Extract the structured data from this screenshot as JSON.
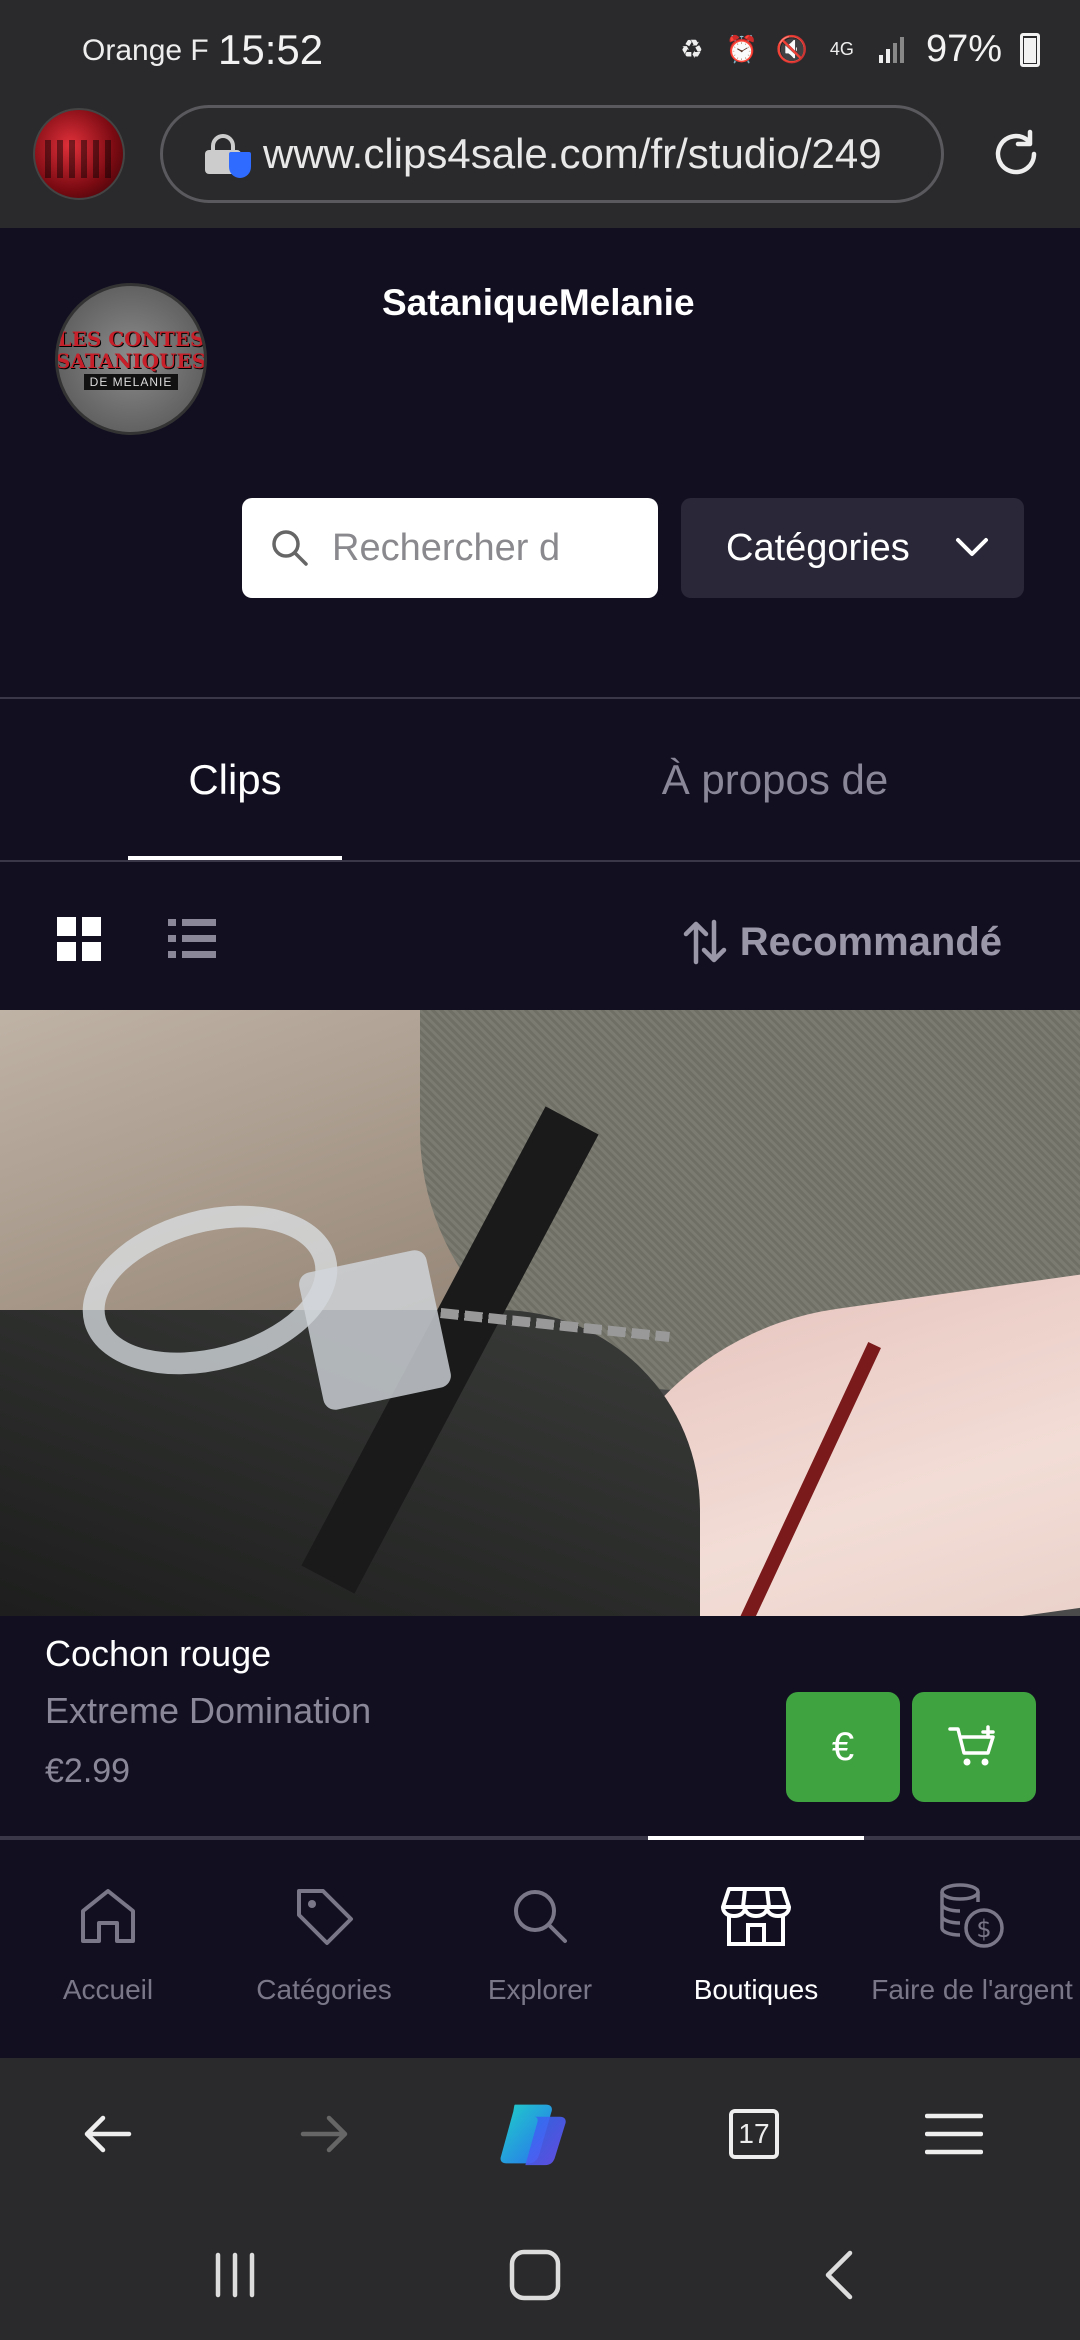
{
  "status_bar": {
    "carrier": "Orange F",
    "time": "15:52",
    "network": "4G",
    "battery": "97%"
  },
  "browser": {
    "url": "www.clips4sale.com/fr/studio/249",
    "tab_count": "17"
  },
  "studio": {
    "name": "SataniqueMelanie",
    "logo_line1": "LES CONTES SATANIQUES",
    "logo_line2": "DE MELANIE"
  },
  "search": {
    "placeholder": "Rechercher d",
    "value": ""
  },
  "categories_dropdown": {
    "label": "Catégories"
  },
  "tabs": [
    {
      "label": "Clips",
      "active": true
    },
    {
      "label": "À propos de",
      "active": false
    }
  ],
  "sort": {
    "label": "Recommandé"
  },
  "clips": [
    {
      "title": "Cochon rouge",
      "category": "Extreme Domination",
      "price": "€2.99",
      "buy_label": "€"
    }
  ],
  "bottom_nav": [
    {
      "label": "Accueil",
      "icon": "home-icon",
      "active": false
    },
    {
      "label": "Catégories",
      "icon": "tag-icon",
      "active": false
    },
    {
      "label": "Explorer",
      "icon": "search-icon",
      "active": false
    },
    {
      "label": "Boutiques",
      "icon": "store-icon",
      "active": true
    },
    {
      "label": "Faire de l'argent",
      "icon": "coins-icon",
      "active": false
    }
  ],
  "colors": {
    "background": "#120f21",
    "accent_green": "#3fa33f",
    "system_bar": "#2a2a2c"
  }
}
